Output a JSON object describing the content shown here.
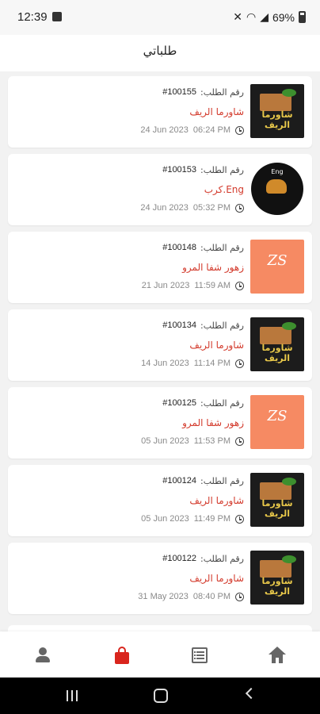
{
  "status_bar": {
    "time": "12:39",
    "battery": "69%"
  },
  "header": {
    "title": "طلباتي"
  },
  "order_label": "رقم الطلب:",
  "orders": [
    {
      "number": "#100155",
      "restaurant": "شاورما الريف",
      "date": "24 Jun 2023",
      "time": "06:24 PM",
      "logo": "shawarma-alreef-logo",
      "logo_text": "شاورما الريف"
    },
    {
      "number": "#100153",
      "restaurant": "Eng.كرب",
      "date": "24 Jun 2023",
      "time": "05:32 PM",
      "logo": "eng-crab-logo",
      "logo_text": "Eng"
    },
    {
      "number": "#100148",
      "restaurant": "زهور شفا المرو",
      "date": "21 Jun 2023",
      "time": "11:59 AM",
      "logo": "zohour-shafa-logo",
      "logo_text": "ZS"
    },
    {
      "number": "#100134",
      "restaurant": "شاورما الريف",
      "date": "14 Jun 2023",
      "time": "11:14 PM",
      "logo": "shawarma-alreef-logo",
      "logo_text": "شاورما الريف"
    },
    {
      "number": "#100125",
      "restaurant": "زهور شفا المرو",
      "date": "05 Jun 2023",
      "time": "11:53 PM",
      "logo": "zohour-shafa-logo",
      "logo_text": "ZS"
    },
    {
      "number": "#100124",
      "restaurant": "شاورما الريف",
      "date": "05 Jun 2023",
      "time": "11:49 PM",
      "logo": "shawarma-alreef-logo",
      "logo_text": "شاورما الريف"
    },
    {
      "number": "#100122",
      "restaurant": "شاورما الريف",
      "date": "31 May 2023",
      "time": "08:40 PM",
      "logo": "shawarma-alreef-logo",
      "logo_text": "شاورما الريف"
    }
  ],
  "bottom_nav": {
    "items": [
      {
        "icon": "profile-icon",
        "active": false
      },
      {
        "icon": "shopping-bag-icon",
        "active": true
      },
      {
        "icon": "list-icon",
        "active": false
      },
      {
        "icon": "home-icon",
        "active": false
      }
    ]
  },
  "colors": {
    "accent": "#d9251d",
    "restaurant_name": "#d33a2c",
    "zs_logo_bg": "#f68a63",
    "background": "#f2f2f2"
  }
}
